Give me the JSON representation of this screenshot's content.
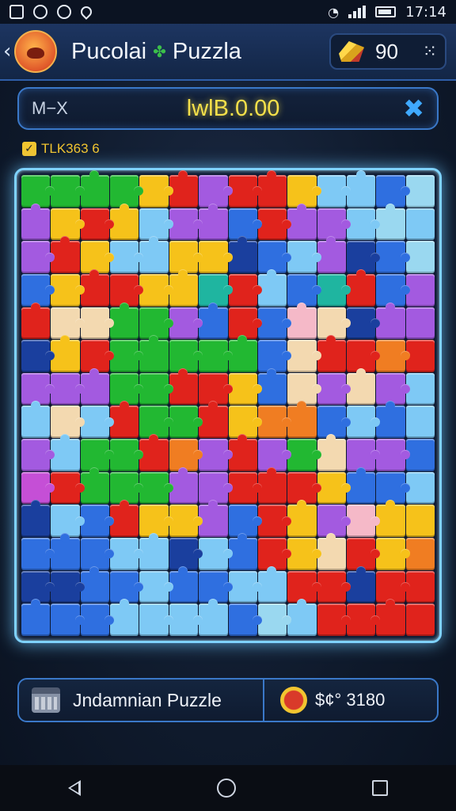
{
  "status_bar": {
    "time": "17:14",
    "icons": [
      "image-icon",
      "messenger-icon",
      "record-icon",
      "location-icon",
      "wifi-icon",
      "signal-icon",
      "battery-icon"
    ]
  },
  "header": {
    "title_left": "Pucolai",
    "title_right": "Puzzla",
    "separator_icon": "clover-icon",
    "coins": "90"
  },
  "info_bar": {
    "left_text": "M−X",
    "center_text": "lwlB.0.00"
  },
  "badge": {
    "text": "TLK363 6"
  },
  "board": {
    "columns": 14,
    "rows": 14,
    "colors": {
      "G": "#22b832",
      "Y": "#f6c21a",
      "R": "#e0231c",
      "P": "#a35ae0",
      "L": "#7ec9f5",
      "B": "#2f6fe0",
      "O": "#f07d22",
      "K": "#f5b9c8",
      "T": "#1fb5a0",
      "C": "#f3d9b0",
      "V": "#c54fd6",
      "N": "#1a3f9e",
      "S": "#9ad8f0",
      "M": "#e8e06a"
    },
    "pieces": [
      "GGGGYRPRRYLLBS",
      "PYRYLPPBRPPLSL",
      "PRYLLYYNBLPNBS",
      "BYRRYYTRLBTRBP",
      "RCCGGPBRBKCNPP",
      "NYRGGGGGBCRROR",
      "PPPGGRRYBCPCPL",
      "LCLRGGRYOOBLBL",
      "PLGGROPRPGCPPB",
      "VRGGGPPRRRYBBL",
      "NLBRYYPBRYPKYY",
      "BBBLLNLBRYCRYO",
      "NNBBLBBLLRRNRR",
      "BBBLLLLBSLRRRR"
    ]
  },
  "bottom_bar": {
    "label": "Jndamnian Puzzle",
    "value": "$¢° 3180"
  }
}
